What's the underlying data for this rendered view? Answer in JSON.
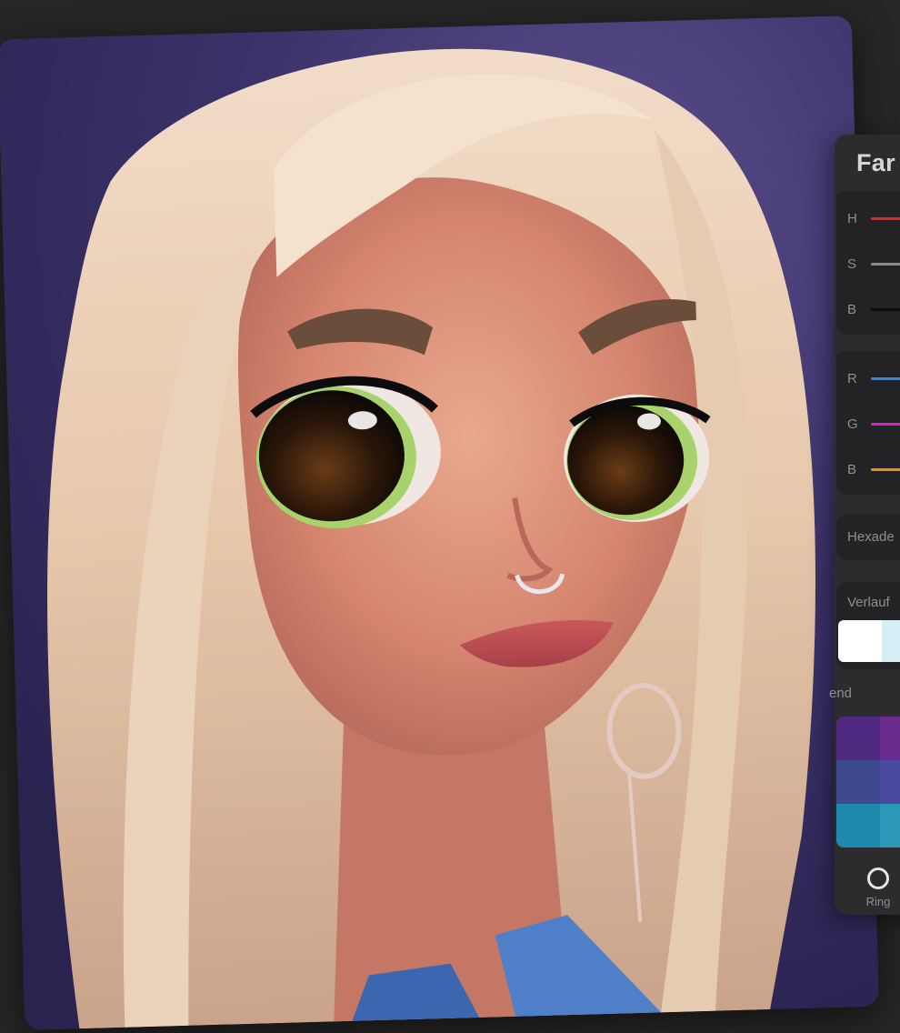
{
  "panel": {
    "title": "Far",
    "hsb": [
      {
        "label": "H",
        "color": "#e8242b"
      },
      {
        "label": "S",
        "color": "#8a8a8a"
      },
      {
        "label": "B",
        "color": "#0a0a0a"
      }
    ],
    "rgb": [
      {
        "label": "R",
        "color": "#2a8be3"
      },
      {
        "label": "G",
        "color": "#d81fc8"
      },
      {
        "label": "B",
        "color": "#f08a1a"
      }
    ],
    "hex_label": "Hexade",
    "gradient_label": "Verlauf",
    "palette_label": "end",
    "tool_label": "Ring"
  },
  "colors": {
    "panel_bg": "#2c2c2e",
    "gradient": [
      "#ffffff",
      "#d6eef5",
      "#a7d8e9"
    ],
    "palette": [
      "#4f2a80",
      "#6a2b8e",
      "#3d4a8f",
      "#4b4aa0",
      "#1f88ad",
      "#2c98b8"
    ]
  },
  "canvas": {
    "subject": "illustrated portrait",
    "background_color": "#3a3168"
  }
}
